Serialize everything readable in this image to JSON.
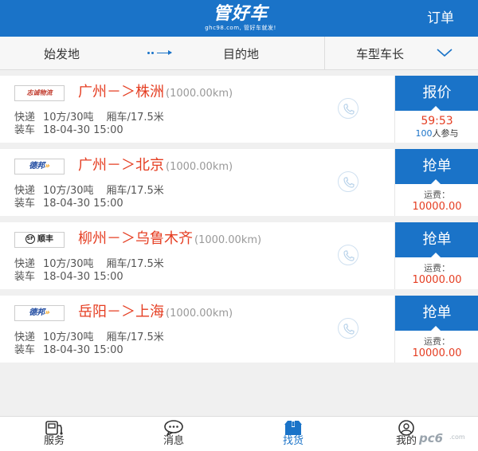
{
  "header": {
    "logo_title": "管好车",
    "logo_subtitle": "ghc98.com, 管好车就发!",
    "order_label": "订单"
  },
  "filter": {
    "origin": "始发地",
    "destination": "目的地",
    "vehicle_type": "车型车长"
  },
  "cards": [
    {
      "logo_text": "志诚物流",
      "route": "广州－＞株洲",
      "distance": "(1000.00km)",
      "category": "快递",
      "capacity": "10方/30吨",
      "truck": "厢车/17.5米",
      "load_label": "装车",
      "load_time": "18-04-30 15:00",
      "action_label": "报价",
      "timer": "59:53",
      "join_count": "100",
      "join_text": "人参与"
    },
    {
      "logo_text": "德邦",
      "route": "广州－＞北京",
      "distance": "(1000.00km)",
      "category": "快递",
      "capacity": "10方/30吨",
      "truck": "厢车/17.5米",
      "load_label": "装车",
      "load_time": "18-04-30 15:00",
      "action_label": "抢单",
      "fee_label": "运费：",
      "fee_value": "10000.00"
    },
    {
      "logo_text": "顺丰",
      "route": "柳州－＞乌鲁木齐",
      "distance": "(1000.00km)",
      "category": "快递",
      "capacity": "10方/30吨",
      "truck": "厢车/17.5米",
      "load_label": "装车",
      "load_time": "18-04-30 15:00",
      "action_label": "抢单",
      "fee_label": "运费：",
      "fee_value": "10000.00"
    },
    {
      "logo_text": "德邦",
      "route": "岳阳－＞上海",
      "distance": "(1000.00km)",
      "category": "快递",
      "capacity": "10方/30吨",
      "truck": "厢车/17.5米",
      "load_label": "装车",
      "load_time": "18-04-30 15:00",
      "action_label": "抢单",
      "fee_label": "运费：",
      "fee_value": "10000.00"
    }
  ],
  "tabbar": [
    {
      "label": "服务",
      "icon": "service-icon"
    },
    {
      "label": "消息",
      "icon": "message-icon"
    },
    {
      "label": "找货",
      "icon": "find-goods-icon",
      "active": true
    },
    {
      "label": "我的",
      "icon": "profile-icon"
    }
  ],
  "watermark": {
    "text": "pc6",
    "sub": ".com"
  },
  "colors": {
    "primary": "#1a73c8",
    "accent": "#e53d21"
  }
}
